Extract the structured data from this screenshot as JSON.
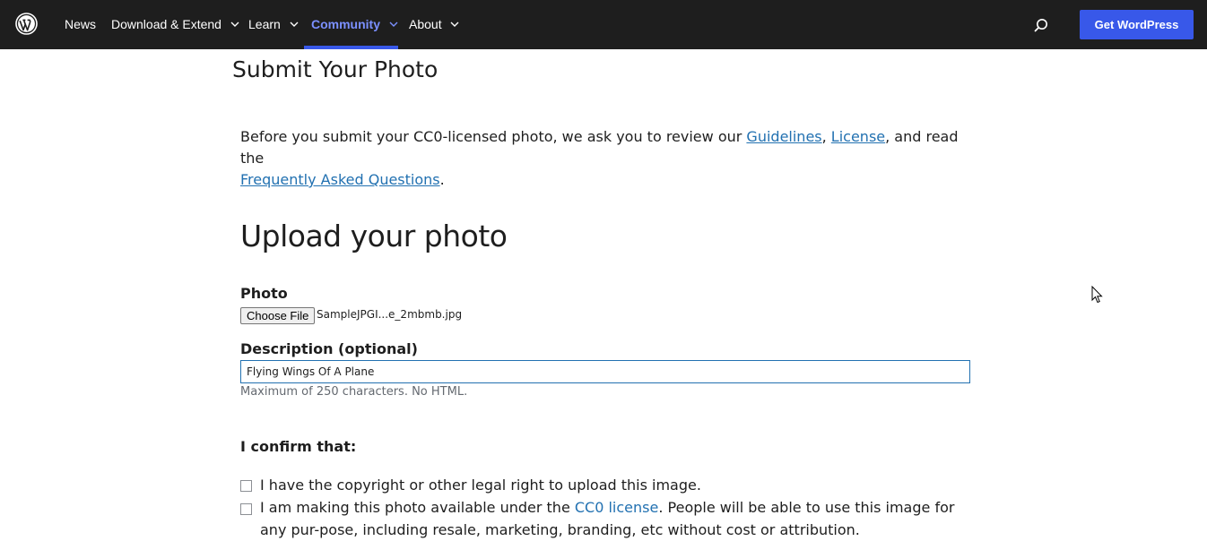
{
  "nav": {
    "items": [
      {
        "label": "News",
        "has_dropdown": false
      },
      {
        "label": "Download & Extend",
        "has_dropdown": true
      },
      {
        "label": "Learn",
        "has_dropdown": true
      },
      {
        "label": "Community",
        "has_dropdown": true,
        "active": true
      },
      {
        "label": "About",
        "has_dropdown": true
      }
    ],
    "cta_label": "Get WordPress",
    "icons": {
      "logo": "wordpress-logo-icon",
      "search": "search-icon"
    }
  },
  "page": {
    "title": "Submit Your Photo",
    "intro": {
      "before": "Before you submit your CC0-licensed photo, we ask you to review our ",
      "link_guidelines": "Guidelines",
      "comma": ", ",
      "link_license": "License",
      "middle": ", and read the ",
      "link_faq": "Frequently Asked Questions",
      "after": "."
    },
    "upload_heading": "Upload your photo",
    "photo_label": "Photo",
    "choose_file_label": "Choose File",
    "file_name": "SampleJPGI...e_2mbmb.jpg",
    "description_label": "Description (optional)",
    "description_value": "Flying Wings Of A Plane",
    "description_help": "Maximum of 250 characters. No HTML.",
    "confirm_heading": "I confirm that:",
    "confirm_1": "I have the copyright or other legal right to upload this image.",
    "confirm_2_before": "I am making this photo available under the ",
    "confirm_2_link": "CC0 license",
    "confirm_2_after": ". People will be able to use this image for any pur-pose, including resale, marketing, branding, etc without cost or attribution."
  },
  "colors": {
    "nav_bg": "#1e1e1e",
    "accent": "#3858e9",
    "link": "#2271b1",
    "active_nav": "#7b90ff"
  }
}
